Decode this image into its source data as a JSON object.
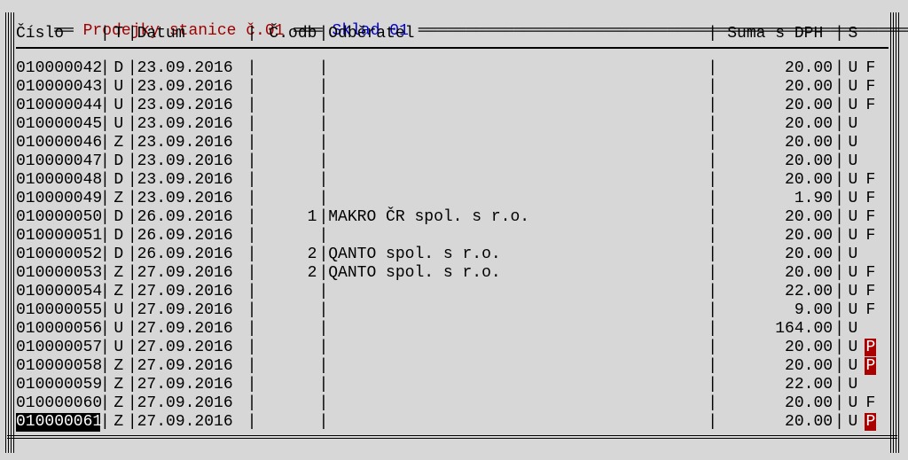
{
  "title_main": " Prodejky stanice č.01 ",
  "title_sub": " Sklad 01 ",
  "header": {
    "cislo": "Číslo",
    "t": "T",
    "datum": "Datum",
    "codb": "Č.odb",
    "odberatel": "Odběratel",
    "suma": "Suma s DPH ",
    "s": "S"
  },
  "rows": [
    {
      "cislo": "010000042",
      "t": "D",
      "datum": "23.09.2016",
      "codb": "",
      "odb": "",
      "suma": "20.00",
      "s1": "U",
      "s2": "F"
    },
    {
      "cislo": "010000043",
      "t": "U",
      "datum": "23.09.2016",
      "codb": "",
      "odb": "",
      "suma": "20.00",
      "s1": "U",
      "s2": "F"
    },
    {
      "cislo": "010000044",
      "t": "U",
      "datum": "23.09.2016",
      "codb": "",
      "odb": "",
      "suma": "20.00",
      "s1": "U",
      "s2": "F"
    },
    {
      "cislo": "010000045",
      "t": "U",
      "datum": "23.09.2016",
      "codb": "",
      "odb": "",
      "suma": "20.00",
      "s1": "U",
      "s2": ""
    },
    {
      "cislo": "010000046",
      "t": "Z",
      "datum": "23.09.2016",
      "codb": "",
      "odb": "",
      "suma": "20.00",
      "s1": "U",
      "s2": ""
    },
    {
      "cislo": "010000047",
      "t": "D",
      "datum": "23.09.2016",
      "codb": "",
      "odb": "",
      "suma": "20.00",
      "s1": "U",
      "s2": ""
    },
    {
      "cislo": "010000048",
      "t": "D",
      "datum": "23.09.2016",
      "codb": "",
      "odb": "",
      "suma": "20.00",
      "s1": "U",
      "s2": "F"
    },
    {
      "cislo": "010000049",
      "t": "Z",
      "datum": "23.09.2016",
      "codb": "",
      "odb": "",
      "suma": "1.90",
      "s1": "U",
      "s2": "F"
    },
    {
      "cislo": "010000050",
      "t": "D",
      "datum": "26.09.2016",
      "codb": "1",
      "odb": "MAKRO ČR spol. s r.o.",
      "suma": "20.00",
      "s1": "U",
      "s2": "F"
    },
    {
      "cislo": "010000051",
      "t": "D",
      "datum": "26.09.2016",
      "codb": "",
      "odb": "",
      "suma": "20.00",
      "s1": "U",
      "s2": "F"
    },
    {
      "cislo": "010000052",
      "t": "D",
      "datum": "26.09.2016",
      "codb": "2",
      "odb": "QANTO spol. s r.o.",
      "suma": "20.00",
      "s1": "U",
      "s2": ""
    },
    {
      "cislo": "010000053",
      "t": "Z",
      "datum": "27.09.2016",
      "codb": "2",
      "odb": "QANTO spol. s r.o.",
      "suma": "20.00",
      "s1": "U",
      "s2": "F"
    },
    {
      "cislo": "010000054",
      "t": "Z",
      "datum": "27.09.2016",
      "codb": "",
      "odb": "",
      "suma": "22.00",
      "s1": "U",
      "s2": "F"
    },
    {
      "cislo": "010000055",
      "t": "U",
      "datum": "27.09.2016",
      "codb": "",
      "odb": "",
      "suma": "9.00",
      "s1": "U",
      "s2": "F"
    },
    {
      "cislo": "010000056",
      "t": "U",
      "datum": "27.09.2016",
      "codb": "",
      "odb": "",
      "suma": "164.00",
      "s1": "U",
      "s2": ""
    },
    {
      "cislo": "010000057",
      "t": "U",
      "datum": "27.09.2016",
      "codb": "",
      "odb": "",
      "suma": "20.00",
      "s1": "U",
      "s2": "P"
    },
    {
      "cislo": "010000058",
      "t": "Z",
      "datum": "27.09.2016",
      "codb": "",
      "odb": "",
      "suma": "20.00",
      "s1": "U",
      "s2": "P"
    },
    {
      "cislo": "010000059",
      "t": "Z",
      "datum": "27.09.2016",
      "codb": "",
      "odb": "",
      "suma": "22.00",
      "s1": "U",
      "s2": ""
    },
    {
      "cislo": "010000060",
      "t": "Z",
      "datum": "27.09.2016",
      "codb": "",
      "odb": "",
      "suma": "20.00",
      "s1": "U",
      "s2": "F"
    },
    {
      "cislo": "010000061",
      "t": "Z",
      "datum": "27.09.2016",
      "codb": "",
      "odb": "",
      "suma": "20.00",
      "s1": "U",
      "s2": "P",
      "selected": true
    }
  ]
}
